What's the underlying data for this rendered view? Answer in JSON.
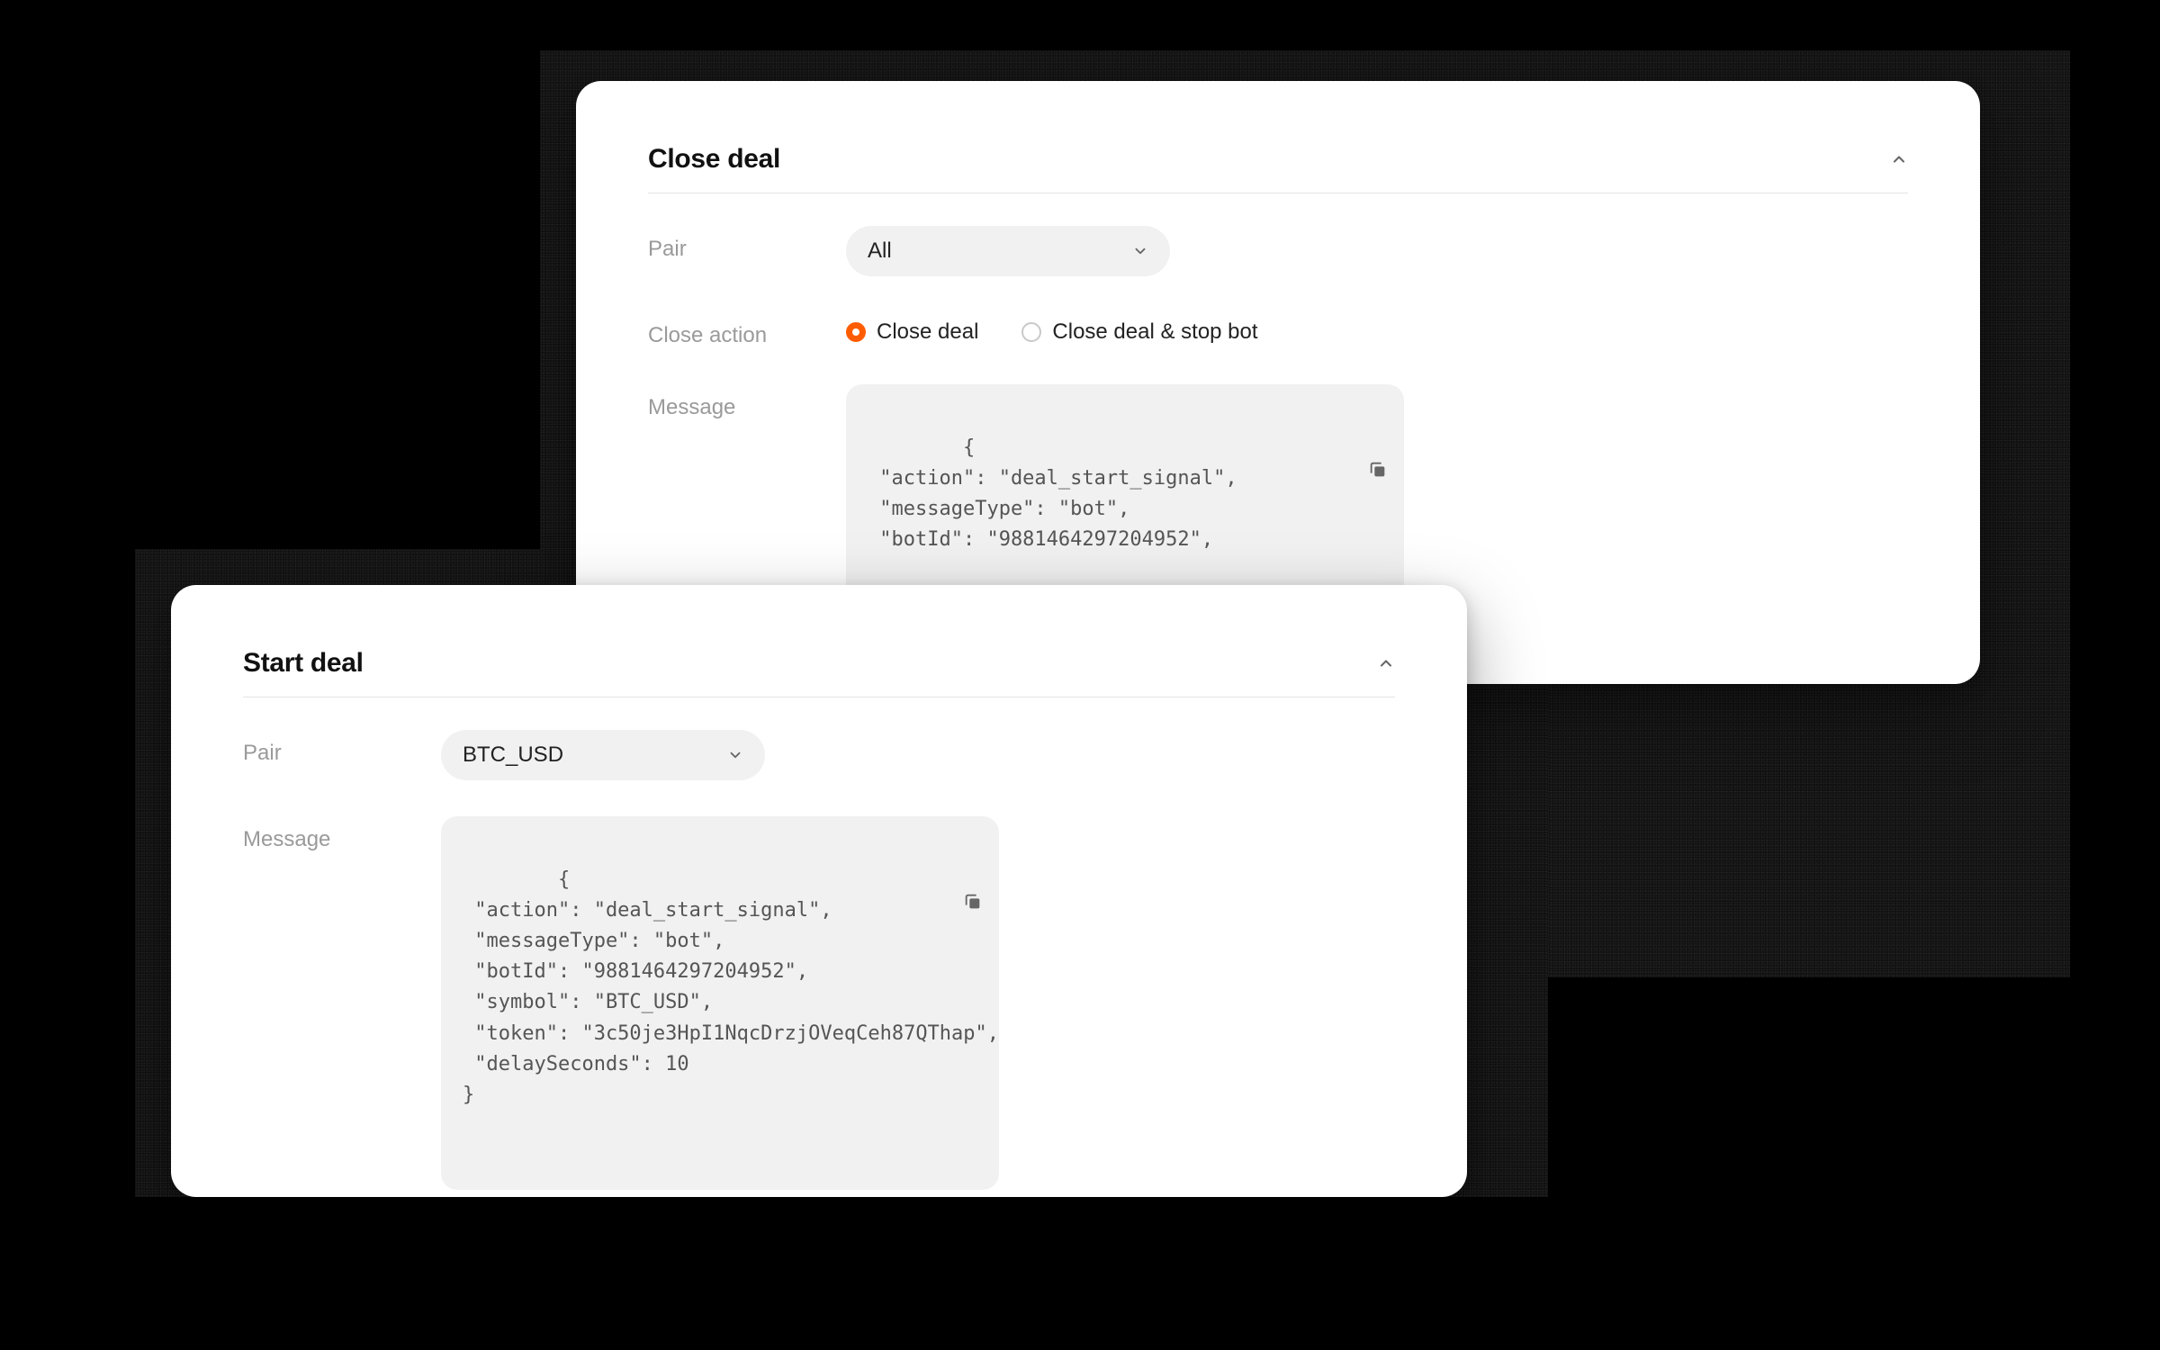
{
  "close_deal": {
    "title": "Close deal",
    "pair_label": "Pair",
    "pair_value": "All",
    "close_action_label": "Close action",
    "radio_options": [
      {
        "label": "Close deal",
        "checked": true
      },
      {
        "label": "Close deal & stop bot",
        "checked": false
      }
    ],
    "message_label": "Message",
    "message_body": "{\n \"action\": \"deal_start_signal\",\n \"messageType\": \"bot\",\n \"botId\": \"9881464297204952\","
  },
  "start_deal": {
    "title": "Start deal",
    "pair_label": "Pair",
    "pair_value": "BTC_USD",
    "message_label": "Message",
    "message_body": "{\n \"action\": \"deal_start_signal\",\n \"messageType\": \"bot\",\n \"botId\": \"9881464297204952\",\n \"symbol\": \"BTC_USD\",\n \"token\": \"3c50je3HpI1NqcDrzjOVeqCeh87QThap\",\n \"delaySeconds\": 10\n}"
  }
}
